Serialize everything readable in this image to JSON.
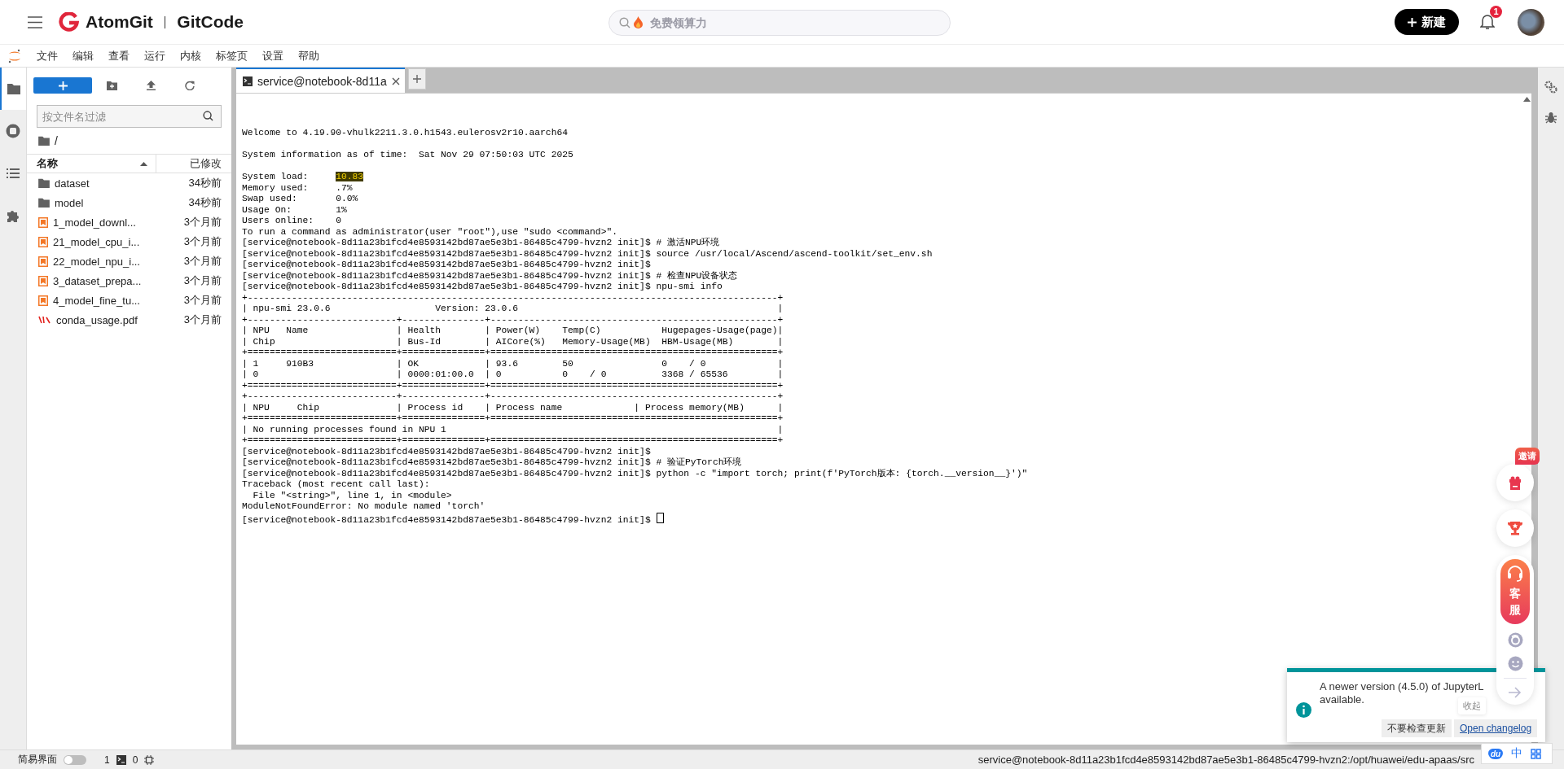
{
  "header": {
    "logo_text": "AtomGit",
    "brand": "GitCode",
    "search": {
      "placeholder": "免费领算力"
    },
    "new_button": "新建",
    "notification_count": "1"
  },
  "menu": [
    "文件",
    "编辑",
    "查看",
    "运行",
    "内核",
    "标签页",
    "设置",
    "帮助"
  ],
  "sidebar_tabs": [
    {
      "kind": "folder",
      "selected": true
    },
    {
      "kind": "running",
      "selected": false
    },
    {
      "kind": "toc",
      "selected": false
    },
    {
      "kind": "extensions",
      "selected": false
    }
  ],
  "file_browser": {
    "filter": {
      "placeholder": "按文件名过滤"
    },
    "path": "/",
    "columns": [
      {
        "label": "名称",
        "sorted": true
      },
      {
        "label": "已修改",
        "sorted": false
      }
    ],
    "files": [
      {
        "kind": "folder",
        "name": "dataset",
        "modified": "34秒前"
      },
      {
        "kind": "folder",
        "name": "model",
        "modified": "34秒前"
      },
      {
        "kind": "notebook",
        "name": "1_model_downl...",
        "modified": "3个月前"
      },
      {
        "kind": "notebook",
        "name": "21_model_cpu_i...",
        "modified": "3个月前"
      },
      {
        "kind": "notebook",
        "name": "22_model_npu_i...",
        "modified": "3个月前"
      },
      {
        "kind": "notebook",
        "name": "3_dataset_prepa...",
        "modified": "3个月前"
      },
      {
        "kind": "notebook",
        "name": "4_model_fine_tu...",
        "modified": "3个月前"
      },
      {
        "kind": "pdf",
        "name": "conda_usage.pdf",
        "modified": "3个月前"
      }
    ]
  },
  "terminal": {
    "tabs": [
      {
        "title": "service@notebook-8d11a",
        "selected": true
      }
    ],
    "cursor": true,
    "blocks": [
      [
        "Welcome to 4.19.90-vhulk2211.3.0.h1543.eulerosv2r10.aarch64"
      ],
      [
        "System information as of time:  Sat Nov 29 07:50:03 UTC 2025"
      ],
      [
        {
          "text": "System load:     ",
          "highlight": "10.83"
        },
        "Memory used:     .7%",
        "Swap used:       0.0%",
        "Usage On:        1%",
        "Users online:    0",
        "To run a command as administrator(user \"root\"),use \"sudo <command>\".",
        "[service@notebook-8d11a23b1fcd4e8593142bd87ae5e3b1-86485c4799-hvzn2 init]$ # 激活NPU环境",
        "[service@notebook-8d11a23b1fcd4e8593142bd87ae5e3b1-86485c4799-hvzn2 init]$ source /usr/local/Ascend/ascend-toolkit/set_env.sh",
        "[service@notebook-8d11a23b1fcd4e8593142bd87ae5e3b1-86485c4799-hvzn2 init]$",
        "[service@notebook-8d11a23b1fcd4e8593142bd87ae5e3b1-86485c4799-hvzn2 init]$ # 检查NPU设备状态",
        "[service@notebook-8d11a23b1fcd4e8593142bd87ae5e3b1-86485c4799-hvzn2 init]$ npu-smi info",
        "+------------------------------------------------------------------------------------------------+",
        "| npu-smi 23.0.6                   Version: 23.0.6                                               |",
        "+---------------------------+---------------+----------------------------------------------------+",
        "| NPU   Name                | Health        | Power(W)    Temp(C)           Hugepages-Usage(page)|",
        "| Chip                      | Bus-Id        | AICore(%)   Memory-Usage(MB)  HBM-Usage(MB)        |",
        "+===========================+===============+====================================================+",
        "| 1     910B3               | OK            | 93.6        50                0    / 0             |",
        "| 0                         | 0000:01:00.0  | 0           0    / 0          3368 / 65536         |",
        "+===========================+===============+====================================================+",
        "+---------------------------+---------------+----------------------------------------------------+",
        "| NPU     Chip              | Process id    | Process name             | Process memory(MB)      |",
        "+===========================+===============+====================================================+",
        "| No running processes found in NPU 1                                                            |",
        "+===========================+===============+====================================================+",
        "[service@notebook-8d11a23b1fcd4e8593142bd87ae5e3b1-86485c4799-hvzn2 init]$",
        "[service@notebook-8d11a23b1fcd4e8593142bd87ae5e3b1-86485c4799-hvzn2 init]$ # 验证PyTorch环境",
        "[service@notebook-8d11a23b1fcd4e8593142bd87ae5e3b1-86485c4799-hvzn2 init]$ python -c \"import torch; print(f'PyTorch版本: {torch.__version__}')\"",
        "Traceback (most recent call last):",
        "  File \"<string>\", line 1, in <module>",
        "ModuleNotFoundError: No module named 'torch'",
        "[service@notebook-8d11a23b1fcd4e8593142bd87ae5e3b1-86485c4799-hvzn2 init]$"
      ]
    ]
  },
  "right_sidebar": [
    {
      "kind": "properties"
    },
    {
      "kind": "debugger"
    }
  ],
  "floating": {
    "invite_badge": "邀请",
    "service_label": "客服",
    "collapse_tooltip": "收起"
  },
  "notification": {
    "lines": [
      "A newer version (4.5.0) of JupyterL",
      "available."
    ],
    "buttons": [
      {
        "label": "不要检查更新",
        "kind": "button"
      },
      {
        "label": "Open changelog",
        "kind": "link"
      }
    ]
  },
  "status_bar": {
    "simple_mode": {
      "label": "简易界面",
      "on": false
    },
    "terminals": "1",
    "kernels": "0",
    "path": "service@notebook-8d11a23b1fcd4e8593142bd87ae5e3b1-86485c4799-hvzn2:/opt/huawei/edu-apaas/src"
  },
  "ime_widget": {
    "logo": "du",
    "language": "中"
  }
}
